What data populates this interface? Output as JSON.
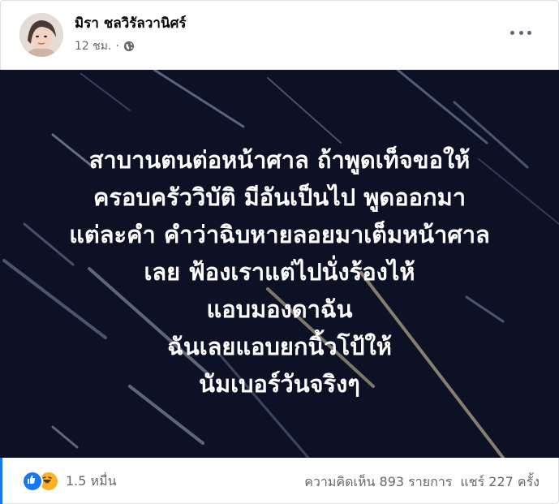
{
  "post": {
    "author": "มิรา ชลวิรัลวานิศร์",
    "time": "12 ชม.",
    "separator": "·",
    "audience_icon": "globe-icon",
    "more_icon": "more-options-icon",
    "text_lines": [
      "สาบานตนต่อหน้าศาล ถ้าพูดเท็จขอให้",
      "ครอบครัววิบัติ มีอันเป็นไป พูดออกมา",
      "แต่ละคำ คำว่าฉิบหายลอยมาเต็มหน้าศาล",
      "เลย ฟ้องเราแต่ไปนั่งร้องไห้",
      "แอบมองดาฉัน",
      "ฉันเลยแอบยกนิ้วโป้ให้",
      "นัมเบอร์วันจริงๆ"
    ],
    "background_color": "#0c1126"
  },
  "footer": {
    "reaction_icons": [
      "like-icon",
      "haha-icon"
    ],
    "reaction_count": "1.5 หมื่น",
    "comments": "ความคิดเห็น 893 รายการ",
    "shares": "แชร์ 227 ครั้ง"
  }
}
